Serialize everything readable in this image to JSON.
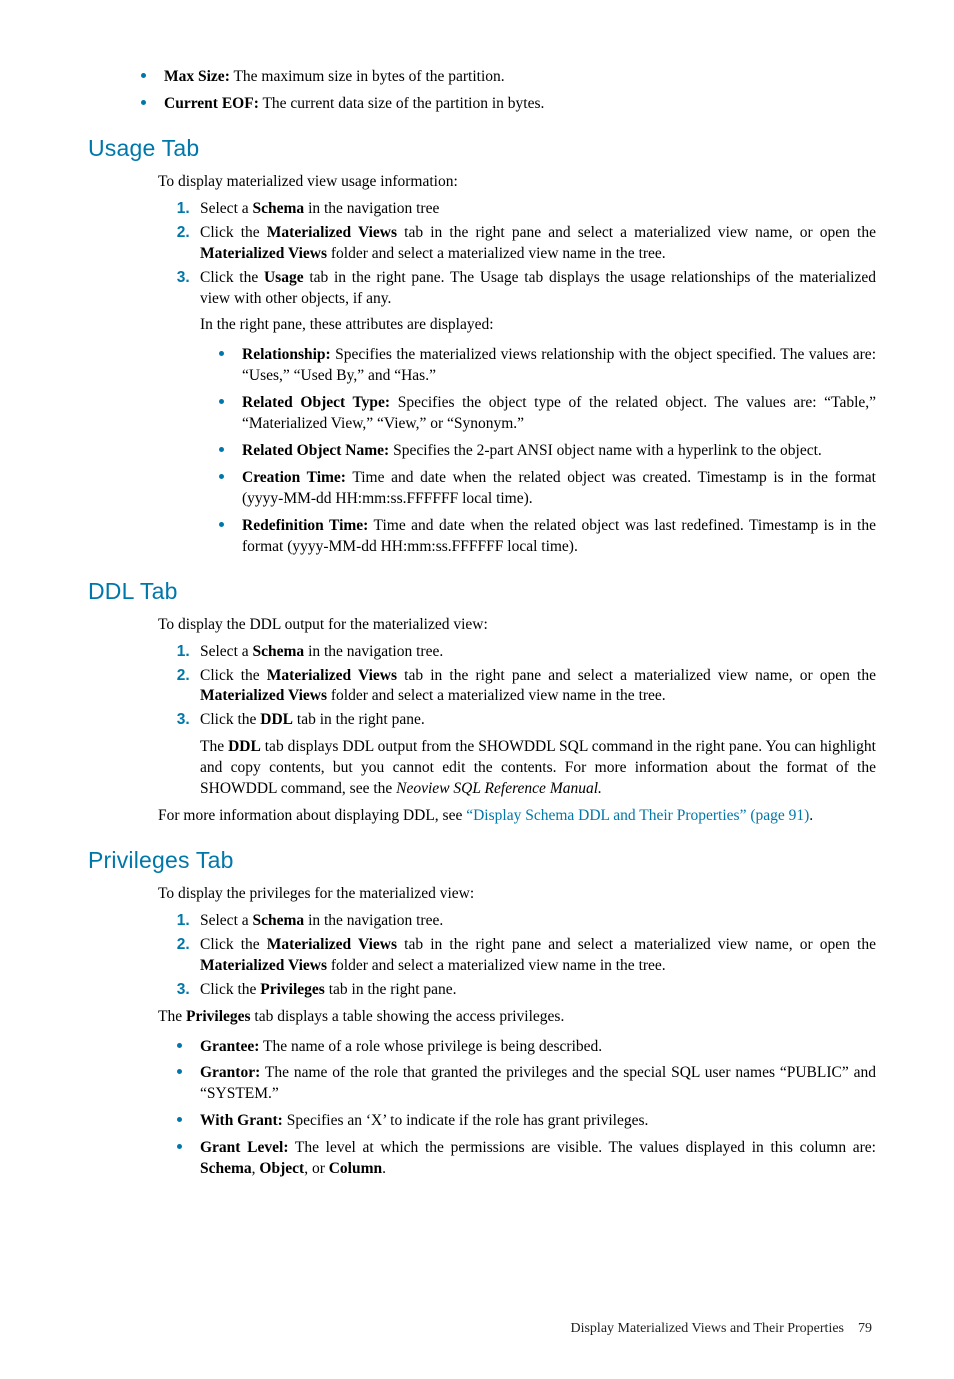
{
  "top_bullets": [
    {
      "term": "Max Size:",
      "desc": " The maximum size in bytes of the partition."
    },
    {
      "term": "Current EOF:",
      "desc": " The current data size of the partition in bytes."
    }
  ],
  "usage": {
    "heading": "Usage Tab",
    "intro": "To display materialized view usage information:",
    "step1_a": "Select a ",
    "step1_b": "Schema",
    "step1_c": " in the navigation tree",
    "step2_a": "Click the ",
    "step2_b": "Materialized Views",
    "step2_c": " tab in the right pane and select a materialized view name, or open the ",
    "step2_d": "Materialized Views",
    "step2_e": " folder and select a materialized view name in the tree.",
    "step3_a": "Click the ",
    "step3_b": "Usage",
    "step3_c": " tab in the right pane. The Usage tab displays the usage relationships of the materialized view with other objects, if any.",
    "step3_para": "In the right pane, these attributes are displayed:",
    "attrs": [
      {
        "term": "Relationship:",
        "desc": " Specifies the materialized views relationship with the object specified. The values are: “Uses,” “Used By,” and “Has.”"
      },
      {
        "term": "Related Object Type:",
        "desc": " Specifies the object type of the related object. The values are: “Table,” “Materialized View,” “View,” or “Synonym.”"
      },
      {
        "term": "Related Object Name:",
        "desc": " Specifies the 2-part ANSI object name with a hyperlink to the object."
      },
      {
        "term": "Creation Time:",
        "desc": " Time and date when the related object was created. Timestamp is in the format (yyyy-MM-dd HH:mm:ss.FFFFFF local time)."
      },
      {
        "term": "Redefinition Time:",
        "desc": " Time and date when the related object was last redefined. Timestamp is in the format (yyyy-MM-dd HH:mm:ss.FFFFFF local time)."
      }
    ]
  },
  "ddl": {
    "heading": "DDL Tab",
    "intro": "To display the DDL output for the materialized view:",
    "step1_a": "Select a ",
    "step1_b": "Schema",
    "step1_c": " in the navigation tree.",
    "step2_a": "Click the ",
    "step2_b": "Materialized Views",
    "step2_c": " tab in the right pane and select a materialized view name, or open the ",
    "step2_d": "Materialized Views",
    "step2_e": " folder and select a materialized view name in the tree.",
    "step3_a": "Click the ",
    "step3_b": "DDL",
    "step3_c": " tab in the right pane.",
    "step3_para_a": "The ",
    "step3_para_b": "DDL",
    "step3_para_c": " tab displays DDL output from the SHOWDDL SQL command in the right pane. You can highlight and copy contents, but you cannot edit the contents. For more information about the format of the SHOWDDL command, see the ",
    "step3_para_d": "Neoview SQL Reference Manual.",
    "more_a": "For more information about displaying DDL, see ",
    "more_link": "“Display Schema DDL and Their Properties” (page 91)",
    "more_b": "."
  },
  "priv": {
    "heading": "Privileges Tab",
    "intro": "To display the privileges for the materialized view:",
    "step1_a": "Select a ",
    "step1_b": "Schema",
    "step1_c": " in the navigation tree.",
    "step2_a": "Click the ",
    "step2_b": "Materialized Views",
    "step2_c": " tab in the right pane and select a materialized view name, or open the ",
    "step2_d": "Materialized Views",
    "step2_e": " folder and select a materialized view name in the tree.",
    "step3_a": "Click the ",
    "step3_b": "Privileges",
    "step3_c": " tab in the right pane.",
    "table_intro_a": "The ",
    "table_intro_b": "Privileges",
    "table_intro_c": " tab displays a table showing the access privileges.",
    "attrs": {
      "grantee": {
        "term": "Grantee:",
        "desc": " The name of a role whose privilege is being described."
      },
      "grantor": {
        "term": "Grantor:",
        "desc": " The name of the role that granted the privileges and the special SQL user names “PUBLIC” and “SYSTEM.”"
      },
      "withgrant": {
        "term": "With Grant:",
        "desc": " Specifies an ‘X’ to indicate if the role has grant privileges."
      },
      "grantlevel": {
        "term": "Grant Level:",
        "a": " The level at which the permissions are visible. The values displayed in this column are: ",
        "v1": "Schema",
        "s1": ", ",
        "v2": "Object",
        "s2": ", or ",
        "v3": "Column",
        "end": "."
      }
    }
  },
  "footer": {
    "title": "Display Materialized Views and Their Properties",
    "page": "79"
  }
}
